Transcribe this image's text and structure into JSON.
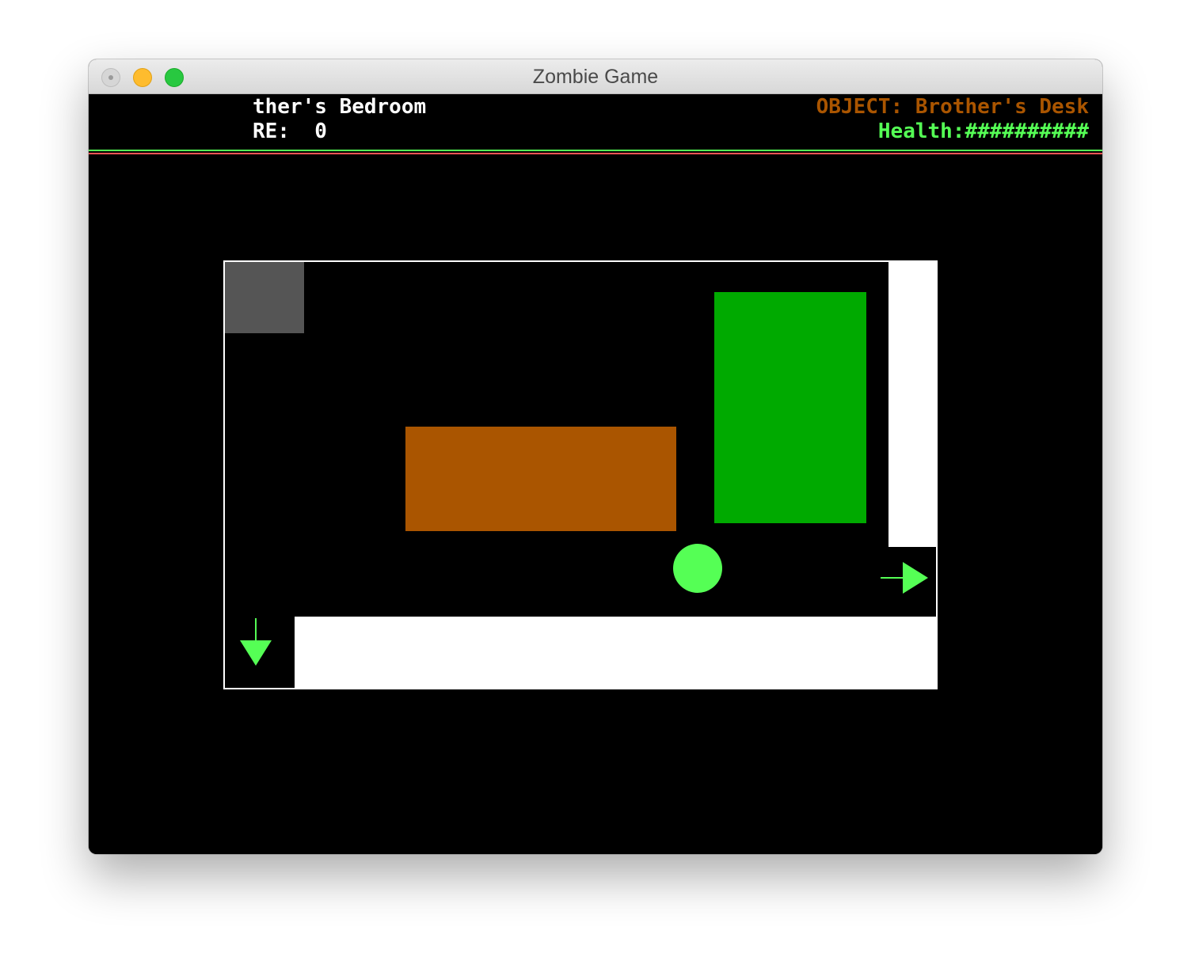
{
  "window": {
    "title": "Zombie Game"
  },
  "hud": {
    "room_name": "ther's Bedroom",
    "score_text": "RE:  0",
    "object_text": "OBJECT: Brother's Desk",
    "health_text": "Health:##########"
  },
  "colors": {
    "hud_text": "#ffffff",
    "object_text": "#aa5500",
    "health_text": "#55ff55",
    "line_top": "#55ff55",
    "line_bottom": "#ff5555",
    "wall": "#ffffff",
    "door_block": "#555555",
    "bed": "#aa5500",
    "desk": "#00aa00",
    "player": "#55ff55",
    "exit_arrow": "#55ff55"
  },
  "icons": {
    "exit_east": "arrow-right-icon",
    "exit_south": "arrow-down-icon",
    "player": "player-circle"
  }
}
